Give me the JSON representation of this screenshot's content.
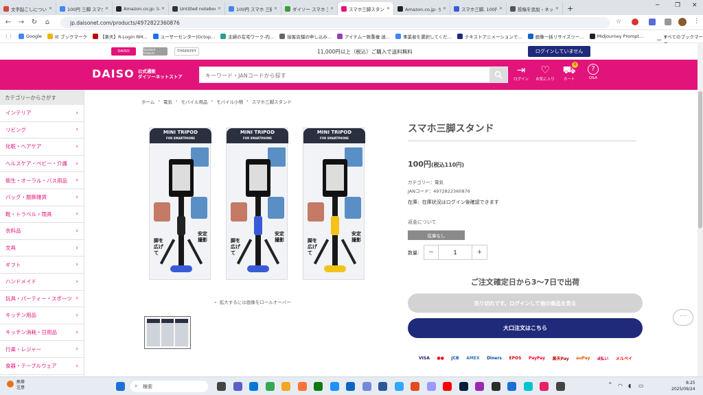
{
  "browser": {
    "tabs": [
      {
        "title": "文字起こしについて",
        "color": "#d44638"
      },
      {
        "title": "100円 三脚 スマホ",
        "color": "#4285f4"
      },
      {
        "title": "Amazon.co.jp: lap",
        "color": "#222222"
      },
      {
        "title": "Untitled notebook",
        "color": "#333333"
      },
      {
        "title": "100円 スマホ 三脚",
        "color": "#4285f4"
      },
      {
        "title": "ダイソー スマホ 三脚",
        "color": "#3c9a3c"
      },
      {
        "title": "スマホ三脚スタンド",
        "color": "#e2137a",
        "active": true
      },
      {
        "title": "Amazon.co.jp: ダイ",
        "color": "#222222"
      },
      {
        "title": "スマホ三脚, 100円",
        "color": "#3b5bdb"
      },
      {
        "title": "投稿を追加 ‹ ネット",
        "color": "#555555"
      }
    ],
    "url": "jp.daisonet.com/products/4972822360876",
    "bookmarks": [
      {
        "label": "Google",
        "color": "#4285f4"
      },
      {
        "label": "IE ブックマーク",
        "color": "#f0b400"
      },
      {
        "label": "【楽天】R-Login RM...",
        "color": "#bf0000"
      },
      {
        "label": "ユーザーセンター|Octop...",
        "color": "#1a73e8"
      },
      {
        "label": "主婦の在宅ワーク-内...",
        "color": "#2a9d8f"
      },
      {
        "label": "接客店舗の申し込み...",
        "color": "#666666"
      },
      {
        "label": "アイテム一致重複 迷...",
        "color": "#8e44ad"
      },
      {
        "label": "事業者を選択してくだ...",
        "color": "#4285f4"
      },
      {
        "label": "テキストアニメーションで...",
        "color": "#1f2a7a"
      },
      {
        "label": "画像一括リサイズツー...",
        "color": "#1565c0"
      },
      {
        "label": "Midjourney Prompt...",
        "color": "#222222"
      }
    ],
    "all_bookmarks": "すべてのブックマーク"
  },
  "site": {
    "brands": [
      "DAISO",
      "Standard Products",
      "THREEPPY"
    ],
    "shipping_notice": "11,000円以上（税込）ご購入で送料無料",
    "login_status": "ログインしていません",
    "logo": {
      "word": "DAISO",
      "line1": "公式通販",
      "line2": "ダイソーネットストア"
    },
    "search_placeholder": "キーワード・JANコードから探す",
    "header_icons": [
      {
        "label": "ログイン",
        "icon": "login-icon",
        "glyph": "⇥"
      },
      {
        "label": "お気に入り",
        "icon": "heart-icon",
        "glyph": "♡"
      },
      {
        "label": "カート",
        "icon": "cart-icon",
        "glyph": "⛟",
        "badge": "0"
      },
      {
        "label": "Q&A",
        "icon": "help-icon",
        "glyph": "?"
      }
    ]
  },
  "sidebar": {
    "heading": "カテゴリーからさがす",
    "categories": [
      "インテリア",
      "リビング",
      "化粧・ヘアケア",
      "ヘルスケア・ベビー・介護",
      "衛生・オーラル・バス用品",
      "バッグ・服飾雑貨",
      "靴・トラベル・雨具",
      "衣料品",
      "文具",
      "ギフト",
      "ハンドメイド",
      "玩具・パーティー・スポーツ",
      "キッチン用品",
      "キッチン消耗・日用品",
      "行楽・レジャー",
      "食器・テーブルウェア"
    ]
  },
  "breadcrumb": [
    "ホーム",
    "電気",
    "モバイル用品",
    "モバイル小物",
    "スマホ三脚スタンド"
  ],
  "gallery": {
    "package_title": "MINI TRIPOD",
    "package_sub": "FOR SMARTPHONE",
    "left_text": "脚を広げて",
    "right_text": "安定撮影",
    "zoom_hint": "拡大するには画像をロールオーバー",
    "variants": [
      {
        "grip": "#222222",
        "feet": "#3a5bd9"
      },
      {
        "grip": "#3a5bd9",
        "feet": "#3a5bd9"
      },
      {
        "grip": "#f2c31a",
        "feet": "#f2c31a"
      }
    ]
  },
  "product": {
    "title": "スマホ三脚スタンド",
    "price": "100円",
    "price_tax": "(税込110円)",
    "category": "カテゴリー：電気",
    "jan": "JANコード：4972822360876",
    "stock_label": "在庫:",
    "stock_text": "在庫状況はログイン後確認できます",
    "refund": "返金について",
    "no_stock": "在庫なし",
    "qty_label": "数量:",
    "qty_value": "1",
    "ship_time": "ご注文確定日から3～7日で出荷",
    "soldout_btn": "売り切れです。ログインして他の商品を見る",
    "bulk_btn": "大口注文はこちら"
  },
  "payments": [
    {
      "label": "VISA",
      "color": "#1a1f71"
    },
    {
      "label": "●●",
      "color": "#eb001b"
    },
    {
      "label": "JCB",
      "color": "#0b4ea2"
    },
    {
      "label": "AMEX",
      "color": "#2e77bb"
    },
    {
      "label": "Diners",
      "color": "#004a97"
    },
    {
      "label": "EPOS",
      "color": "#e60012"
    },
    {
      "label": "PayPay",
      "color": "#ff0033"
    },
    {
      "label": "楽天Pay",
      "color": "#bf0000"
    },
    {
      "label": "auPay",
      "color": "#eb5505"
    },
    {
      "label": "d払い",
      "color": "#cc0033"
    },
    {
      "label": "メルペイ",
      "color": "#ff0211"
    }
  ],
  "taskbar": {
    "weather_temp": "熱帯",
    "weather_sub": "注意",
    "search_placeholder": "検索",
    "time": "8:25",
    "date": "2025/09/24"
  }
}
